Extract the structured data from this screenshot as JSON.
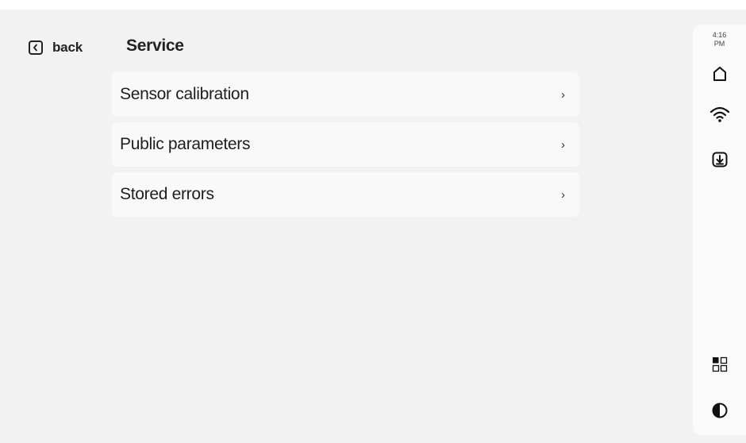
{
  "header": {
    "back_label": "back",
    "title": "Service"
  },
  "menu": {
    "items": [
      {
        "label": "Sensor calibration",
        "chevron": "›"
      },
      {
        "label": "Public parameters",
        "chevron": "›"
      },
      {
        "label": "Stored errors",
        "chevron": "›"
      }
    ]
  },
  "status": {
    "time": "4:16",
    "ampm": "PM"
  },
  "icons": {
    "back": "chevron-left-icon",
    "home": "home-icon",
    "wifi": "wifi-icon",
    "download": "download-icon",
    "apps": "apps-grid-icon",
    "contrast": "contrast-icon"
  },
  "colors": {
    "background": "#f2f2f2",
    "card": "#f9f9f9",
    "rail": "#fafafa",
    "text": "#222222"
  }
}
